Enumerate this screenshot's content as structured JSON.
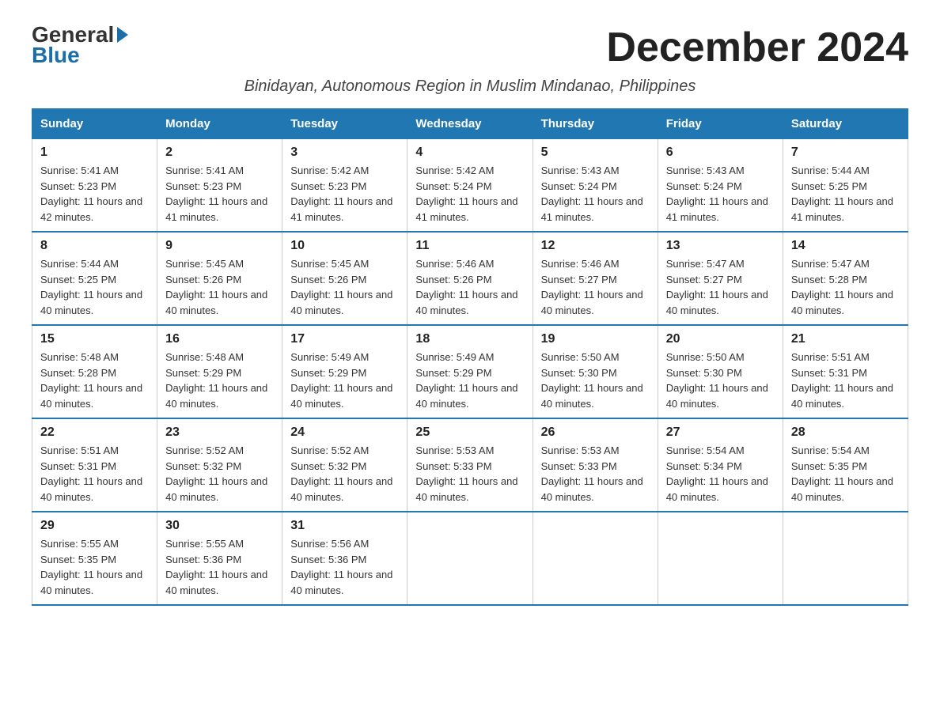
{
  "logo": {
    "general": "General",
    "blue": "Blue"
  },
  "title": "December 2024",
  "subtitle": "Binidayan, Autonomous Region in Muslim Mindanao, Philippines",
  "headers": [
    "Sunday",
    "Monday",
    "Tuesday",
    "Wednesday",
    "Thursday",
    "Friday",
    "Saturday"
  ],
  "weeks": [
    [
      {
        "day": "1",
        "sunrise": "5:41 AM",
        "sunset": "5:23 PM",
        "daylight": "11 hours and 42 minutes."
      },
      {
        "day": "2",
        "sunrise": "5:41 AM",
        "sunset": "5:23 PM",
        "daylight": "11 hours and 41 minutes."
      },
      {
        "day": "3",
        "sunrise": "5:42 AM",
        "sunset": "5:23 PM",
        "daylight": "11 hours and 41 minutes."
      },
      {
        "day": "4",
        "sunrise": "5:42 AM",
        "sunset": "5:24 PM",
        "daylight": "11 hours and 41 minutes."
      },
      {
        "day": "5",
        "sunrise": "5:43 AM",
        "sunset": "5:24 PM",
        "daylight": "11 hours and 41 minutes."
      },
      {
        "day": "6",
        "sunrise": "5:43 AM",
        "sunset": "5:24 PM",
        "daylight": "11 hours and 41 minutes."
      },
      {
        "day": "7",
        "sunrise": "5:44 AM",
        "sunset": "5:25 PM",
        "daylight": "11 hours and 41 minutes."
      }
    ],
    [
      {
        "day": "8",
        "sunrise": "5:44 AM",
        "sunset": "5:25 PM",
        "daylight": "11 hours and 40 minutes."
      },
      {
        "day": "9",
        "sunrise": "5:45 AM",
        "sunset": "5:26 PM",
        "daylight": "11 hours and 40 minutes."
      },
      {
        "day": "10",
        "sunrise": "5:45 AM",
        "sunset": "5:26 PM",
        "daylight": "11 hours and 40 minutes."
      },
      {
        "day": "11",
        "sunrise": "5:46 AM",
        "sunset": "5:26 PM",
        "daylight": "11 hours and 40 minutes."
      },
      {
        "day": "12",
        "sunrise": "5:46 AM",
        "sunset": "5:27 PM",
        "daylight": "11 hours and 40 minutes."
      },
      {
        "day": "13",
        "sunrise": "5:47 AM",
        "sunset": "5:27 PM",
        "daylight": "11 hours and 40 minutes."
      },
      {
        "day": "14",
        "sunrise": "5:47 AM",
        "sunset": "5:28 PM",
        "daylight": "11 hours and 40 minutes."
      }
    ],
    [
      {
        "day": "15",
        "sunrise": "5:48 AM",
        "sunset": "5:28 PM",
        "daylight": "11 hours and 40 minutes."
      },
      {
        "day": "16",
        "sunrise": "5:48 AM",
        "sunset": "5:29 PM",
        "daylight": "11 hours and 40 minutes."
      },
      {
        "day": "17",
        "sunrise": "5:49 AM",
        "sunset": "5:29 PM",
        "daylight": "11 hours and 40 minutes."
      },
      {
        "day": "18",
        "sunrise": "5:49 AM",
        "sunset": "5:29 PM",
        "daylight": "11 hours and 40 minutes."
      },
      {
        "day": "19",
        "sunrise": "5:50 AM",
        "sunset": "5:30 PM",
        "daylight": "11 hours and 40 minutes."
      },
      {
        "day": "20",
        "sunrise": "5:50 AM",
        "sunset": "5:30 PM",
        "daylight": "11 hours and 40 minutes."
      },
      {
        "day": "21",
        "sunrise": "5:51 AM",
        "sunset": "5:31 PM",
        "daylight": "11 hours and 40 minutes."
      }
    ],
    [
      {
        "day": "22",
        "sunrise": "5:51 AM",
        "sunset": "5:31 PM",
        "daylight": "11 hours and 40 minutes."
      },
      {
        "day": "23",
        "sunrise": "5:52 AM",
        "sunset": "5:32 PM",
        "daylight": "11 hours and 40 minutes."
      },
      {
        "day": "24",
        "sunrise": "5:52 AM",
        "sunset": "5:32 PM",
        "daylight": "11 hours and 40 minutes."
      },
      {
        "day": "25",
        "sunrise": "5:53 AM",
        "sunset": "5:33 PM",
        "daylight": "11 hours and 40 minutes."
      },
      {
        "day": "26",
        "sunrise": "5:53 AM",
        "sunset": "5:33 PM",
        "daylight": "11 hours and 40 minutes."
      },
      {
        "day": "27",
        "sunrise": "5:54 AM",
        "sunset": "5:34 PM",
        "daylight": "11 hours and 40 minutes."
      },
      {
        "day": "28",
        "sunrise": "5:54 AM",
        "sunset": "5:35 PM",
        "daylight": "11 hours and 40 minutes."
      }
    ],
    [
      {
        "day": "29",
        "sunrise": "5:55 AM",
        "sunset": "5:35 PM",
        "daylight": "11 hours and 40 minutes."
      },
      {
        "day": "30",
        "sunrise": "5:55 AM",
        "sunset": "5:36 PM",
        "daylight": "11 hours and 40 minutes."
      },
      {
        "day": "31",
        "sunrise": "5:56 AM",
        "sunset": "5:36 PM",
        "daylight": "11 hours and 40 minutes."
      },
      null,
      null,
      null,
      null
    ]
  ]
}
